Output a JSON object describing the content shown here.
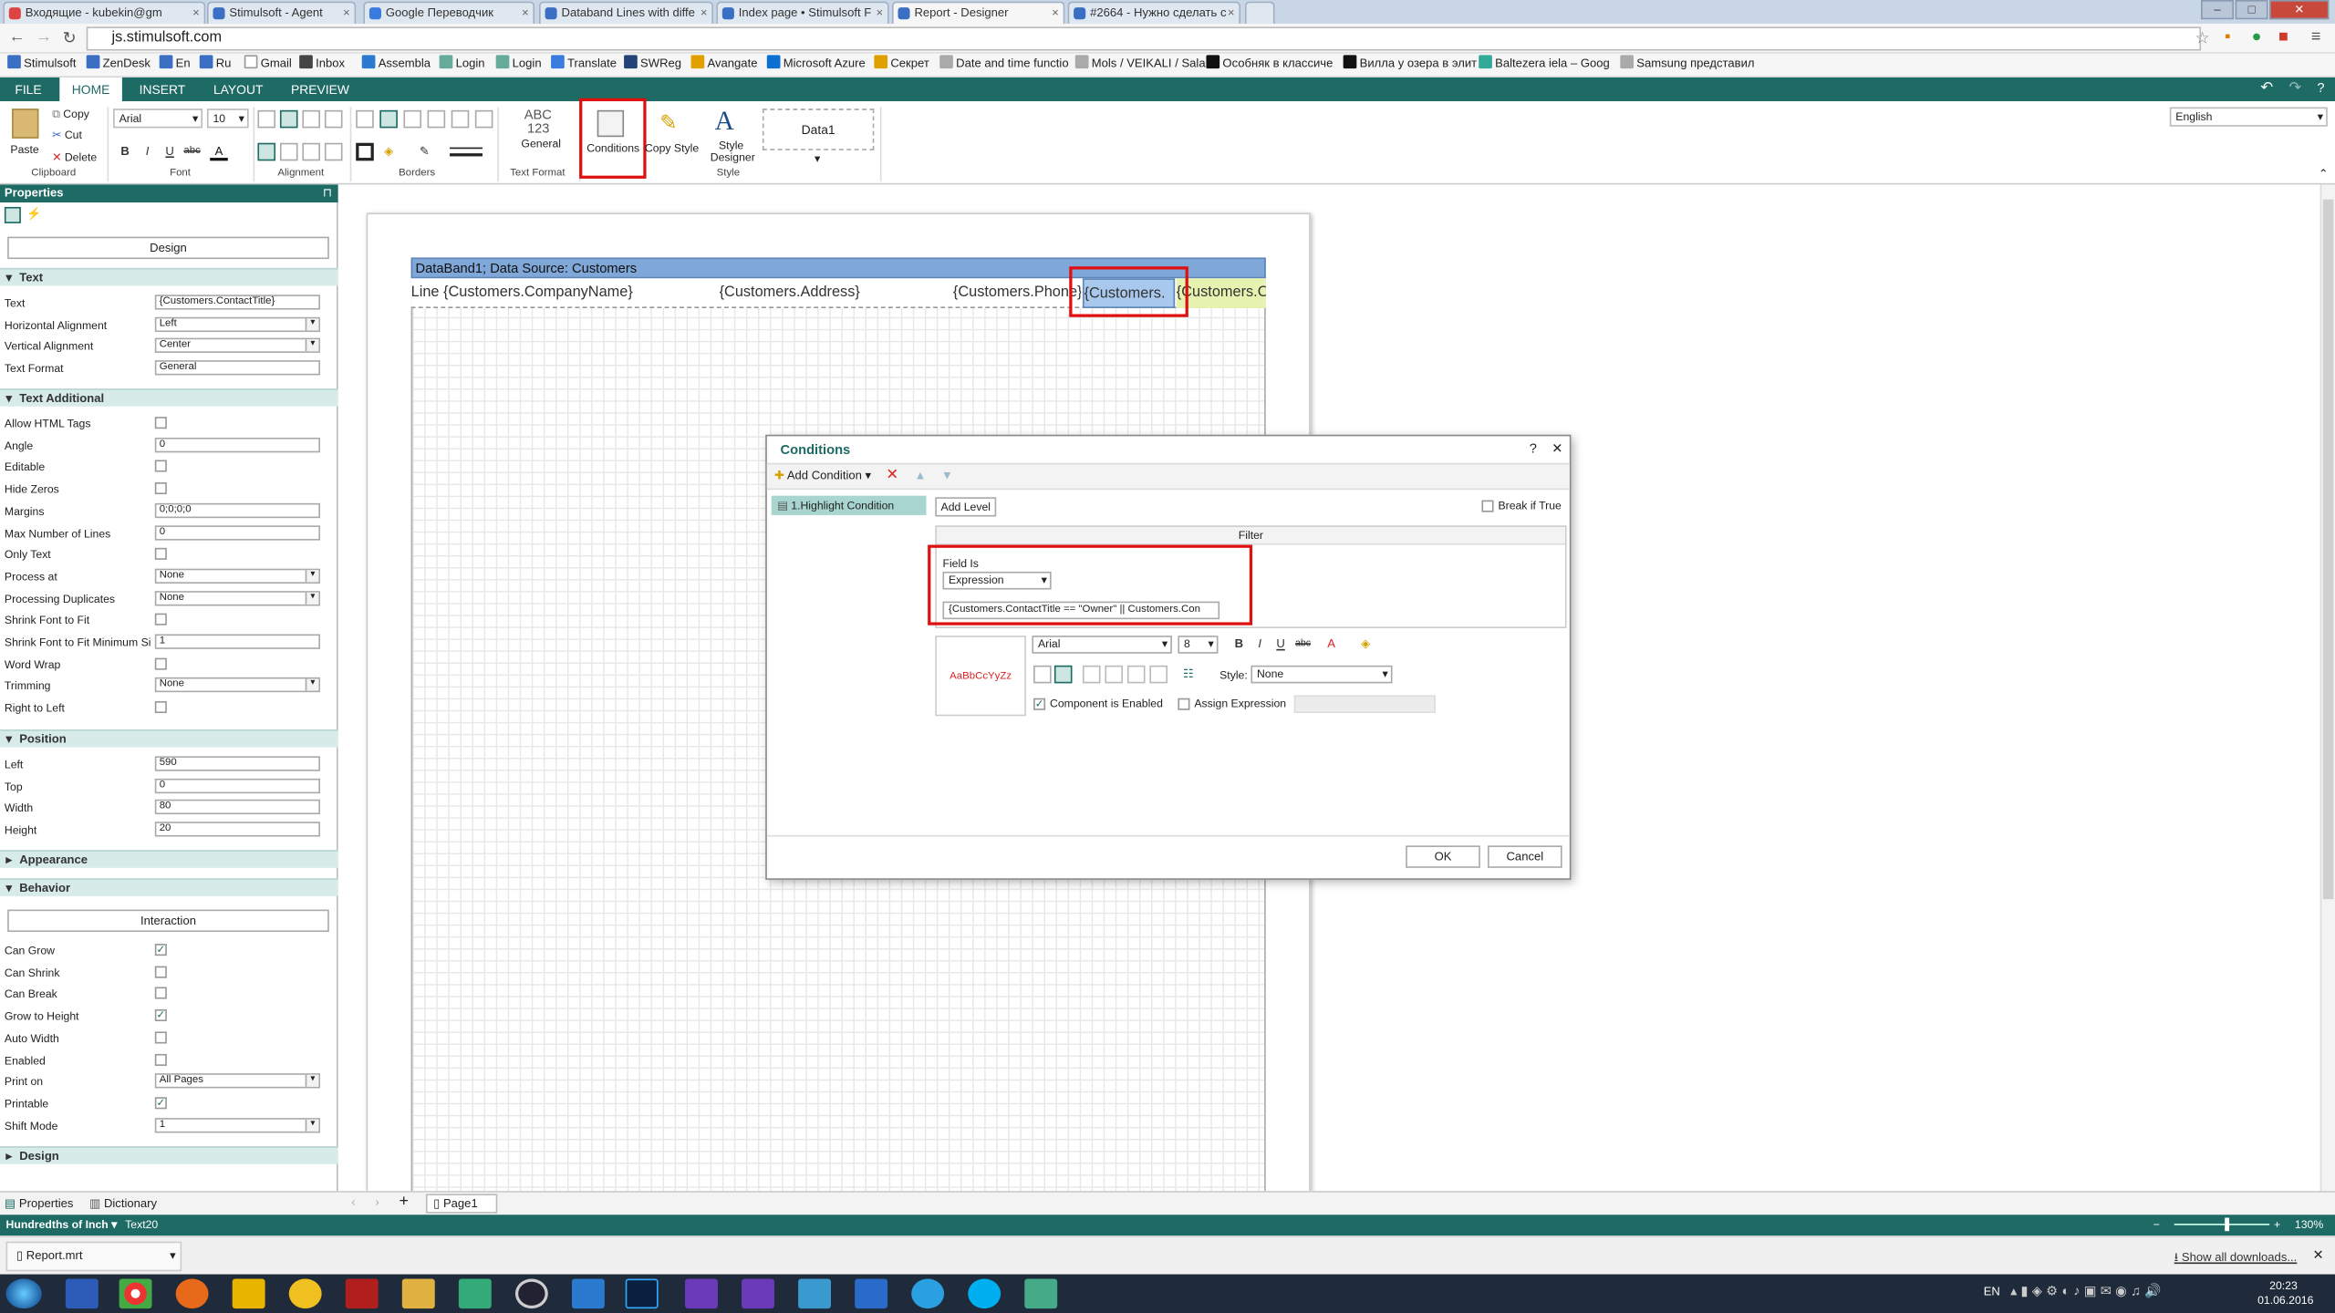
{
  "browser": {
    "tabs": [
      {
        "label": "Входящие - kubekin@gm",
        "color": "#d44"
      },
      {
        "label": "Stimulsoft - Agent",
        "color": "#3a6fc4"
      },
      {
        "label": "Google Переводчик",
        "color": "#3a7be0"
      },
      {
        "label": "Databand Lines with diffe",
        "color": "#3a6fc4"
      },
      {
        "label": "Index page • Stimulsoft F",
        "color": "#3a6fc4"
      },
      {
        "label": "Report - Designer",
        "color": "#3a6fc4"
      },
      {
        "label": "#2664 - Нужно сделать с",
        "color": "#3a6fc4"
      }
    ],
    "url": "js.stimulsoft.com",
    "bookmarks": [
      "Stimulsoft",
      "ZenDesk",
      "En",
      "Ru",
      "Gmail",
      "Inbox",
      "Assembla",
      "Login",
      "Login",
      "Translate",
      "SWReg",
      "Avangate",
      "Microsoft Azure",
      "Секрет",
      "Date and time functio",
      "Mols / VEIKALI / Sala",
      "Особняк в классиче",
      "Вилла у озера в элит",
      "Baltezera iela – Goog",
      "Samsung представил"
    ]
  },
  "ribbon": {
    "tabs": [
      "FILE",
      "HOME",
      "INSERT",
      "LAYOUT",
      "PREVIEW"
    ],
    "clipboard": {
      "paste": "Paste",
      "copy": "Copy",
      "cut": "Cut",
      "delete": "Delete",
      "group": "Clipboard"
    },
    "font": {
      "name": "Arial",
      "size": "10",
      "group": "Font",
      "bold": "B",
      "italic": "I",
      "underline": "U",
      "strike": "abc",
      "color": "A"
    },
    "alignment_group": "Alignment",
    "borders_group": "Borders",
    "text_format": {
      "abc": "ABC",
      "num": "123",
      "label": "General",
      "group": "Text Format"
    },
    "conditions": "Conditions",
    "copy_style": "Copy Style",
    "style_designer": "Style Designer",
    "style_glyph": "A",
    "style_group": "Style",
    "style_box": "Data1",
    "language": "English"
  },
  "properties": {
    "header": "Properties",
    "design_button": "Design",
    "sections": {
      "text": "Text",
      "text_additional": "Text Additional",
      "position": "Position",
      "appearance": "Appearance",
      "behavior": "Behavior",
      "design": "Design"
    },
    "text_rows": [
      {
        "label": "Text",
        "value": "{Customers.ContactTitle}"
      },
      {
        "label": "Horizontal Alignment",
        "value": "Left"
      },
      {
        "label": "Vertical Alignment",
        "value": "Center"
      },
      {
        "label": "Text Format",
        "value": "General"
      }
    ],
    "text_additional_rows": [
      {
        "label": "Allow HTML Tags"
      },
      {
        "label": "Angle",
        "value": "0"
      },
      {
        "label": "Editable"
      },
      {
        "label": "Hide Zeros"
      },
      {
        "label": "Margins",
        "value": "0;0;0;0"
      },
      {
        "label": "Max Number of Lines",
        "value": "0"
      },
      {
        "label": "Only Text"
      },
      {
        "label": "Process at",
        "value": "None"
      },
      {
        "label": "Processing Duplicates",
        "value": "None"
      },
      {
        "label": "Shrink Font to Fit"
      },
      {
        "label": "Shrink Font to Fit Minimum Si",
        "value": "1"
      },
      {
        "label": "Word Wrap"
      },
      {
        "label": "Trimming",
        "value": "None"
      },
      {
        "label": "Right to Left"
      }
    ],
    "position_rows": [
      {
        "label": "Left",
        "value": "590"
      },
      {
        "label": "Top",
        "value": "0"
      },
      {
        "label": "Width",
        "value": "80"
      },
      {
        "label": "Height",
        "value": "20"
      }
    ],
    "interaction_button": "Interaction",
    "behavior_rows": [
      {
        "label": "Can Grow",
        "checked": true
      },
      {
        "label": "Can Shrink",
        "checked": false
      },
      {
        "label": "Can Break",
        "checked": false
      },
      {
        "label": "Grow to Height",
        "checked": true
      },
      {
        "label": "Auto Width",
        "checked": false
      },
      {
        "label": "Enabled",
        "checked": false
      },
      {
        "label": "Print on",
        "value": "All Pages"
      },
      {
        "label": "Printable",
        "checked": true
      },
      {
        "label": "Shift Mode",
        "value": "1"
      }
    ],
    "bottom_tabs": [
      "Properties",
      "Dictionary"
    ]
  },
  "report": {
    "band_title": "DataBand1; Data Source: Customers",
    "cells": [
      "Line {Customers.CompanyName}",
      "{Customers.Address}",
      "{Customers.Phone}",
      "{Customers.",
      "{Customers.C"
    ],
    "page_tab": "Page1"
  },
  "dialog": {
    "title": "Conditions",
    "help": "?",
    "close": "✕",
    "add_condition": "Add Condition",
    "condition_item": "1.Highlight Condition",
    "add_level": "Add Level",
    "break_if_true": "Break if True",
    "filter_header": "Filter",
    "field_is_label": "Field Is",
    "field_is_value": "Expression",
    "expression": "{Customers.ContactTitle == \"Owner\" || Customers.Con",
    "sample_text": "AaBbCcYyZz",
    "font_name": "Arial",
    "font_size": "8",
    "bold": "B",
    "italic": "I",
    "underline": "U",
    "strike": "abc",
    "style_label": "Style:",
    "style_value": "None",
    "component_enabled": "Component is Enabled",
    "assign_expression": "Assign Expression",
    "ok": "OK",
    "cancel": "Cancel"
  },
  "status": {
    "units": "Hundredths of Inch",
    "component": "Text20",
    "zoom": "130%"
  },
  "download": {
    "file": "Report.mrt",
    "show_all": "Show all downloads..."
  },
  "taskbar": {
    "lang": "EN",
    "time": "20:23",
    "date": "01.06.2016"
  }
}
